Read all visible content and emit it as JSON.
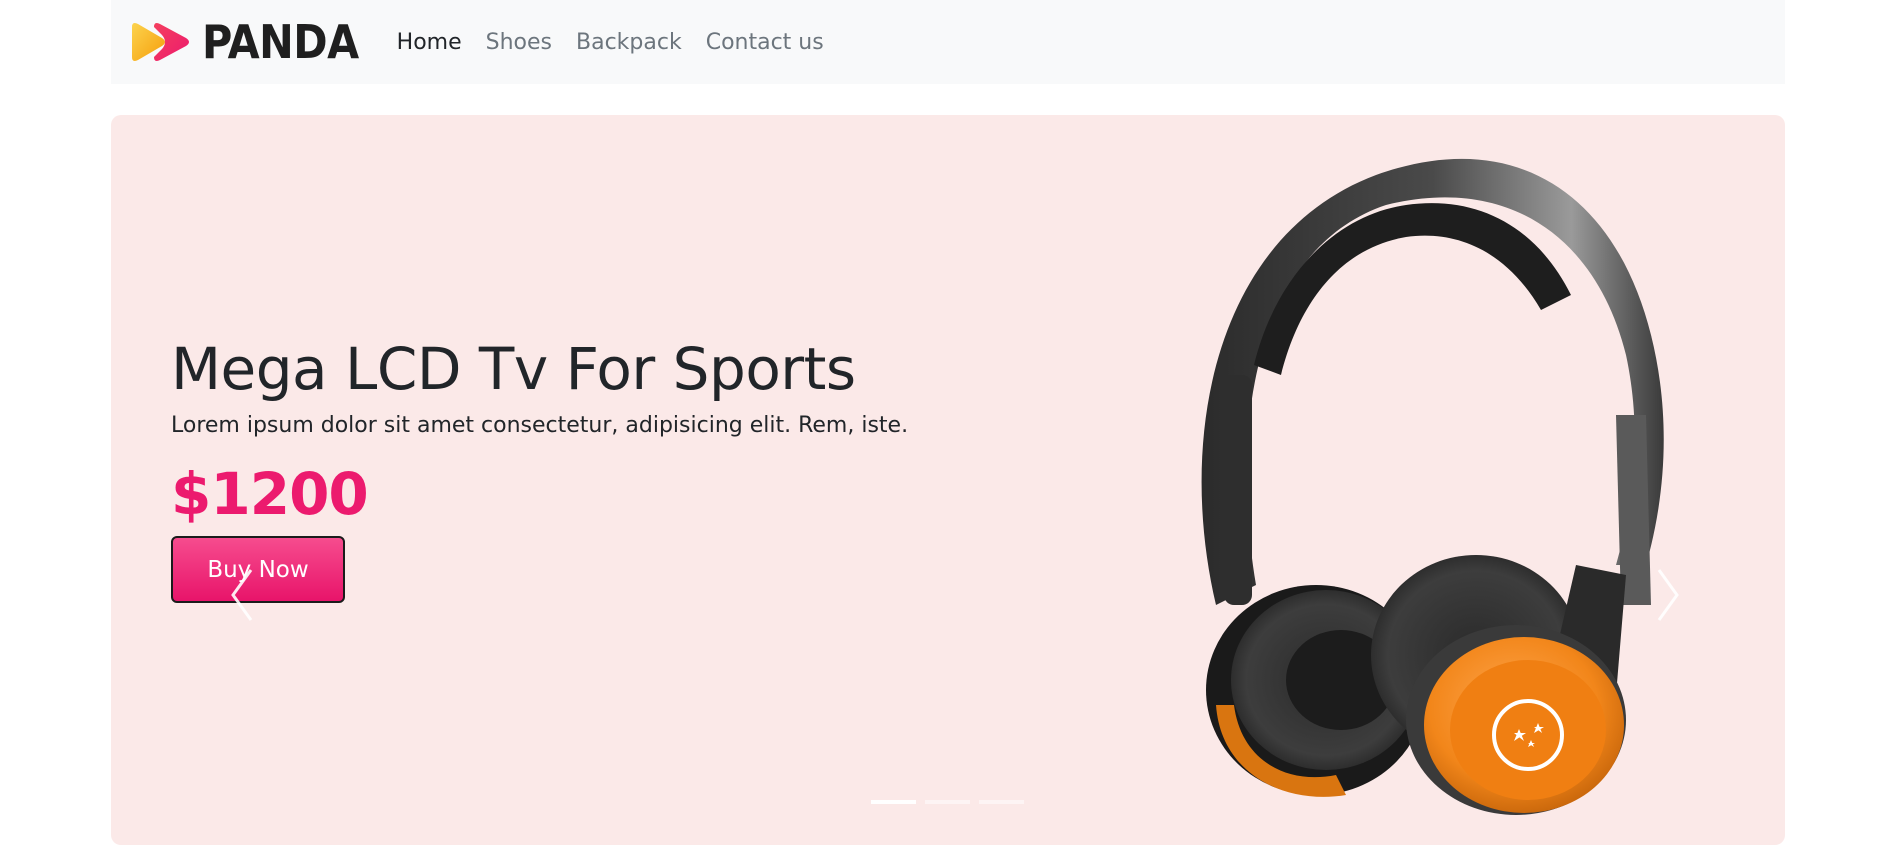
{
  "brand": {
    "name": "PANDA",
    "logo_icon": "play-chevrons-logo",
    "colors": [
      "#f9b233",
      "#ec1a6e"
    ]
  },
  "nav": {
    "items": [
      {
        "label": "Home",
        "active": true
      },
      {
        "label": "Shoes",
        "active": false
      },
      {
        "label": "Backpack",
        "active": false
      },
      {
        "label": "Contact us",
        "active": false
      }
    ]
  },
  "hero": {
    "title": "Mega LCD Tv For Sports",
    "description": "Lorem ipsum dolor sit amet consectetur, adipisicing elit. Rem, iste.",
    "price": "$1200",
    "button_label": "Buy Now",
    "image": "headphones-product-image",
    "background": "#fbe9e8",
    "accent": "#ec1a6e"
  },
  "carousel": {
    "prev_icon": "chevron-left-icon",
    "next_icon": "chevron-right-icon",
    "slide_count": 3,
    "active_index": 0
  }
}
